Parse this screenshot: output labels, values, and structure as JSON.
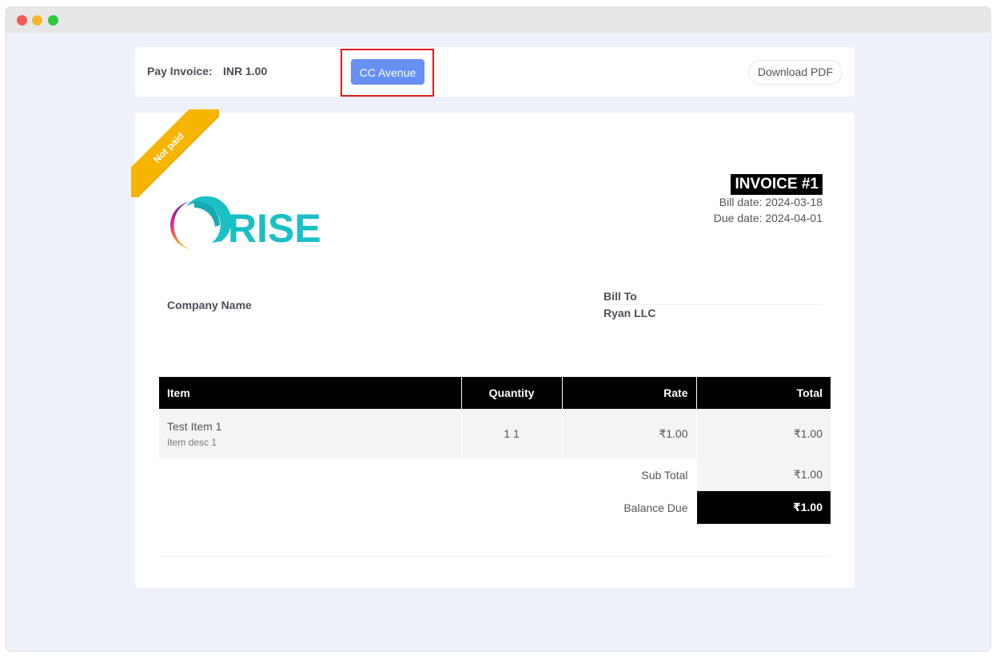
{
  "pay": {
    "label": "Pay Invoice:",
    "amount": "INR 1.00",
    "cc_button": "CC Avenue",
    "download_label": "Download PDF"
  },
  "ribbon": {
    "status": "Not paid"
  },
  "logo": {
    "text": "RISE"
  },
  "invoice": {
    "title": "INVOICE #1",
    "bill_date": "Bill date: 2024-03-18",
    "due_date": "Due date: 2024-04-01"
  },
  "company": {
    "name": "Company Name"
  },
  "bill_to": {
    "label": "Bill To",
    "name": "Ryan LLC"
  },
  "table": {
    "headers": {
      "item": "Item",
      "quantity": "Quantity",
      "rate": "Rate",
      "total": "Total"
    },
    "rows": [
      {
        "title": "Test Item 1",
        "desc": "Item desc 1",
        "quantity": "1 1",
        "rate": "₹1.00",
        "total": "₹1.00"
      }
    ],
    "sub_total_label": "Sub Total",
    "sub_total_value": "₹1.00",
    "balance_due_label": "Balance Due",
    "balance_due_value": "₹1.00"
  },
  "colors": {
    "primary_button": "#6690f4",
    "highlight_box": "#e41b1b",
    "ribbon": "#f8b500",
    "logo_teal": "#1bbfc4"
  }
}
